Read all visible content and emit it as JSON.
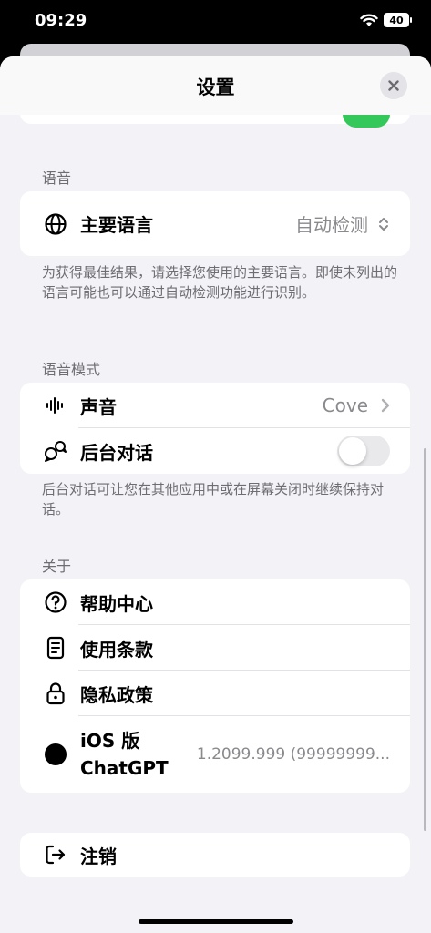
{
  "status": {
    "time": "09:29",
    "battery": "40"
  },
  "sheet": {
    "title": "设置"
  },
  "language": {
    "header": "语音",
    "primary_label": "主要语言",
    "primary_value": "自动检测",
    "footnote": "为获得最佳结果，请选择您使用的主要语言。即使未列出的语言可能也可以通过自动检测功能进行识别。"
  },
  "voice_mode": {
    "header": "语音模式",
    "voice_label": "声音",
    "voice_value": "Cove",
    "background_label": "后台对话",
    "background_enabled": false,
    "footnote": "后台对话可让您在其他应用中或在屏幕关闭时继续保持对话。"
  },
  "about": {
    "header": "关于",
    "help_label": "帮助中心",
    "terms_label": "使用条款",
    "privacy_label": "隐私政策",
    "version_label_line1": "iOS 版",
    "version_label_line2": "ChatGPT",
    "version_value": "1.2099.999 (99999999..."
  },
  "logout": {
    "label": "注销"
  },
  "colors": {
    "toggle_on": "#34c759",
    "background": "#f2f2f7"
  }
}
